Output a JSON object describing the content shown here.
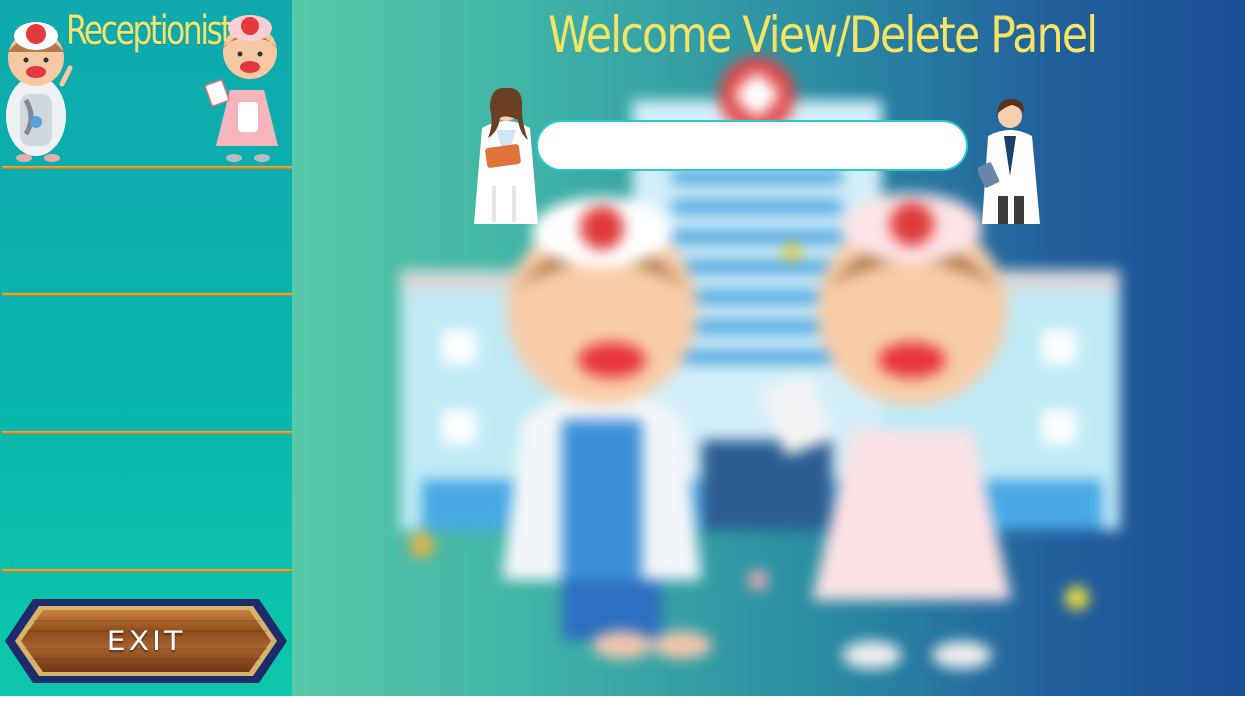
{
  "sidebar": {
    "title": "Receptionist",
    "exit_label": "EXIT",
    "slots": [
      "",
      "",
      ""
    ]
  },
  "main": {
    "title": "Welcome View/Delete Panel",
    "input_value": "",
    "input_placeholder": ""
  },
  "icons": {
    "sidebar_left": "kid-doctor-icon",
    "sidebar_right": "kid-nurse-icon",
    "main_left": "female-doctor-icon",
    "main_right": "male-doctor-icon",
    "background": "hospital-illustration"
  },
  "colors": {
    "title_yellow": "#f5e463",
    "sidebar_teal": "#0fa9ad",
    "divider_orange": "#e09a2a",
    "input_border": "#27c9cf",
    "exit_border": "#1d2b6b",
    "exit_wood": "#8a4a1a"
  }
}
